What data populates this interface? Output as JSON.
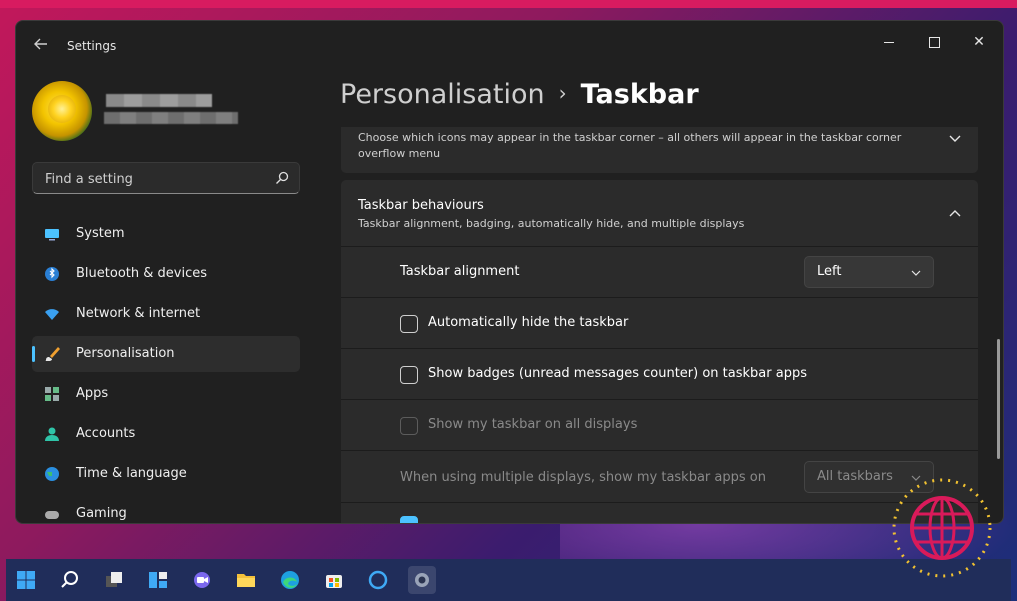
{
  "window": {
    "app_title": "Settings",
    "controls": {
      "minimize": "minimize",
      "maximize": "maximize",
      "close": "✕"
    }
  },
  "search": {
    "placeholder": "Find a setting"
  },
  "sidebar": {
    "items": [
      {
        "label": "System",
        "icon": "system-icon",
        "active": false
      },
      {
        "label": "Bluetooth & devices",
        "icon": "bluetooth-icon",
        "active": false
      },
      {
        "label": "Network & internet",
        "icon": "wifi-icon",
        "active": false
      },
      {
        "label": "Personalisation",
        "icon": "brush-icon",
        "active": true
      },
      {
        "label": "Apps",
        "icon": "apps-icon",
        "active": false
      },
      {
        "label": "Accounts",
        "icon": "accounts-icon",
        "active": false
      },
      {
        "label": "Time & language",
        "icon": "globe-icon",
        "active": false
      },
      {
        "label": "Gaming",
        "icon": "gaming-icon",
        "active": false
      }
    ]
  },
  "breadcrumb": {
    "parent": "Personalisation",
    "separator": "›",
    "current": "Taskbar"
  },
  "corner_overflow": {
    "description": "Choose which icons may appear in the taskbar corner – all others will appear in the taskbar corner overflow menu"
  },
  "behaviours": {
    "title": "Taskbar behaviours",
    "subtitle": "Taskbar alignment, badging, automatically hide, and multiple displays",
    "alignment": {
      "label": "Taskbar alignment",
      "value": "Left"
    },
    "auto_hide": {
      "label": "Automatically hide the taskbar",
      "checked": false
    },
    "badges": {
      "label": "Show badges (unread messages counter) on taskbar apps",
      "checked": false
    },
    "all_displays": {
      "label": "Show my taskbar on all displays",
      "checked": false,
      "disabled": true
    },
    "multi_display": {
      "label": "When using multiple displays, show my taskbar apps on",
      "value": "All taskbars",
      "disabled": true
    },
    "next_row": {
      "checked": true
    }
  },
  "taskbar": {
    "icons": [
      "start-icon",
      "search-icon",
      "task-view-icon",
      "widgets-icon",
      "chat-icon",
      "file-explorer-icon",
      "edge-icon",
      "store-icon",
      "cortana-icon",
      "settings-icon"
    ]
  },
  "colors": {
    "accent": "#4cc2ff",
    "window_bg": "#202020",
    "card_bg": "#2b2b2b",
    "taskbar_bg": "#202d5a",
    "logo": "#d91a5a"
  }
}
